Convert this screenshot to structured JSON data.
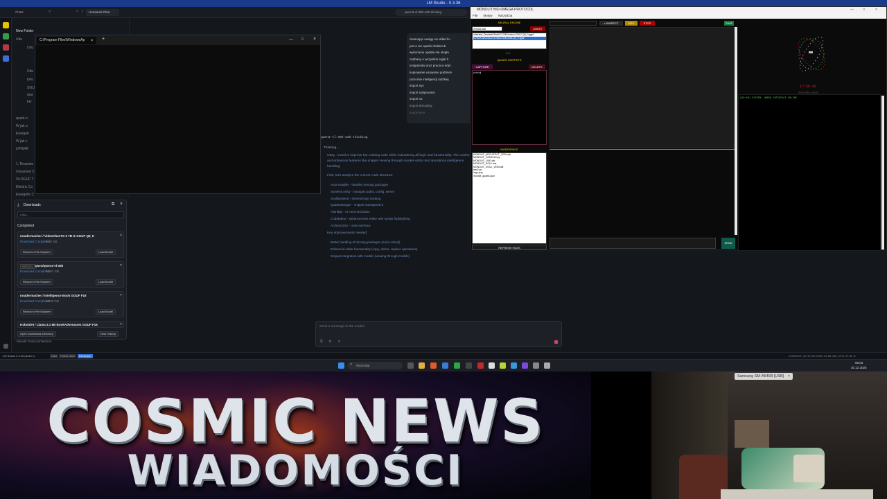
{
  "lm": {
    "title": "LM Studio - 0.3.36",
    "url_fragment": "qwen3-vl-30b-a3b-thinking",
    "top_tabs": [
      "Chats",
      "Unnamed Chat"
    ],
    "sidebar": {
      "new_folder": "New Folder",
      "items": [
        "Ubu",
        "ipsu",
        "SOU",
        "qua",
        "ker",
        "quark-n",
        "W jak u",
        "Energeti",
        "W jak c",
        "UPGRA",
        "1. Reaction",
        "Unnamed C",
        "OLOGUF T",
        "Elektric Co",
        "Energetic C"
      ]
    },
    "terminal_tab": "C:\\Program Files\\WindowsAp",
    "status_bar": {
      "app": "LM Studio 0.3.36 (Build 1)",
      "user": "User",
      "power_user": "Power User",
      "developer": "Developer",
      "bottom_left": "Monolit Final Architecture",
      "right": "CONTEXT: 12 /67.5% RAM: 52.65 GB | CPU: 37.30 %"
    }
  },
  "downloads": {
    "title": "Downloads",
    "filter_placeholder": "Filter...",
    "section": "Completed",
    "items": [
      {
        "name": "mradermacher / VideoChat R1 5 7B I1 GGUF Q8_K",
        "status": "Download Completed",
        "size": "8.10 GB"
      },
      {
        "name": "qwen/qwen3-vl-30b",
        "status": "Download Completed",
        "size": "16.97 GB",
        "tag": "MODEL"
      },
      {
        "name": "mradermacher / Intelligence Book GGUF F16",
        "status": "Download Completed",
        "size": "16.39 GB"
      },
      {
        "name": "KoboldAI / Llama 3.1 8B BookAdventures GGUF F16",
        "status": "",
        "size": ""
      }
    ],
    "reveal": "Reveal in File Explorer",
    "load": "Load Model",
    "open_dir": "Open Downloads Directory",
    "clear": "Clear History"
  },
  "chat": {
    "bubble_lines": [
      "zwracając uwagę na układ ko",
      "jest a nie wpełni działa lub",
      "wykonaniu update nie uległa",
      "zadbany o wszystkie logiki k",
      "snippetsów oraz praca w edyt",
      "kopiowanie usuwanie podmien",
      "poziomie inteligencji ludzkiej",
      "import sys",
      "import subprocess",
      "import os",
      "import threading",
      "import time"
    ],
    "model": "qwen3-vl-30b-a3b-thinking",
    "thinking": "Thinking...",
    "response": "Okay, I need to improve the existing code while maintaining all logic and functionality. The crashes and enhances features like snippet viewing through models editor text operations intelligence handling.",
    "analyze": "First, let's analyze the current code structure:",
    "structure": [
      "Auto-Installer - handles missing packages",
      "SystemConfig - manages paths, config, server",
      "SoulBackend - time/entropy tracking",
      "QuarkManager - snippet management",
      "AIBridge - AI communication",
      "CodeEditor - advanced text editor with syntax highlighting",
      "ArchitectGUI - main interface"
    ],
    "key_label": "Key improvements needed:",
    "improvements": [
      "Better handling of missing packages (more robust)",
      "Enhanced editor functionality (copy, delete, replace operations)",
      "Snippet integration with models (viewing through models)"
    ],
    "input_placeholder": "Send a message to the model..."
  },
  "qw": {
    "title": "MONOLIT BIO-OMEGA PROTOCOL",
    "menu": [
      "File",
      "Motyw",
      "Narzędzia"
    ],
    "neural_engine": "NEURAL ENGINE",
    "model_id": "20000168",
    "ignite": "IGNITE",
    "model_lines": [
      "mistralai_Devstral-Small-2-24B-Instruct-2512-Q8_0.gguf",
      "NVIDIA-Nemotron-3-Nano-30B-A3B-Q8_0.gguf"
    ],
    "dev_count": "1/11",
    "quark_label": "QUARK SNIPPETS",
    "capture": "CAPTURE",
    "delete": "DELETE",
    "snippet_item": "poiuhdj",
    "workspace_label": "WORKSPACE",
    "files": [
      "MONOLIT_ARCHITECT_VEIN.dat",
      "MONOLIT_CODEx10.py",
      "MONOLIT_LIVE.dat",
      "MONOLIT_SOUL.dat",
      "MONOLIT_SOUL_VEIN.dat",
      "test2.py",
      "logo.png",
      "monolit_quarks.json"
    ],
    "refresh": "REFRESH FILES",
    "inspect": "INSPECT",
    "dev": "DEV",
    "stop": "STOP",
    "save": "SAVE",
    "time": "17:56:42",
    "syslog_label": "SYSTEM LOGS",
    "syslog_line": "[00:00] SYSTEM: OMEGA INTERFACE ONLINE.",
    "send": "SEND"
  },
  "taskbar": {
    "search_placeholder": "Wyszukaj",
    "clock_time": "06:03",
    "clock_date": "30.12.2025"
  },
  "banner": {
    "line1": "COSMIC NEWS",
    "line2": "WIADOMOŚCI"
  },
  "cam": {
    "label": "Samsung SM-A546B [USB]"
  }
}
